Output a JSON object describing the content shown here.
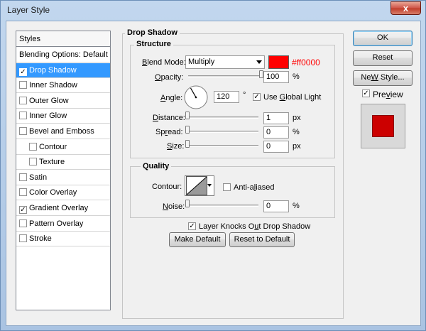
{
  "window": {
    "title": "Layer Style",
    "close_glyph": "x"
  },
  "styles_panel": {
    "header": "Styles",
    "items": [
      {
        "label": "Blending Options: Default",
        "checkbox": false,
        "checked": false,
        "selected": false,
        "indent": false
      },
      {
        "label": "Drop Shadow",
        "checkbox": true,
        "checked": true,
        "selected": true,
        "indent": false
      },
      {
        "label": "Inner Shadow",
        "checkbox": true,
        "checked": false,
        "selected": false,
        "indent": false
      },
      {
        "label": "Outer Glow",
        "checkbox": true,
        "checked": false,
        "selected": false,
        "indent": false
      },
      {
        "label": "Inner Glow",
        "checkbox": true,
        "checked": false,
        "selected": false,
        "indent": false
      },
      {
        "label": "Bevel and Emboss",
        "checkbox": true,
        "checked": false,
        "selected": false,
        "indent": false
      },
      {
        "label": "Contour",
        "checkbox": true,
        "checked": false,
        "selected": false,
        "indent": true
      },
      {
        "label": "Texture",
        "checkbox": true,
        "checked": false,
        "selected": false,
        "indent": true
      },
      {
        "label": "Satin",
        "checkbox": true,
        "checked": false,
        "selected": false,
        "indent": false
      },
      {
        "label": "Color Overlay",
        "checkbox": true,
        "checked": false,
        "selected": false,
        "indent": false
      },
      {
        "label": "Gradient Overlay",
        "checkbox": true,
        "checked": true,
        "selected": false,
        "indent": false
      },
      {
        "label": "Pattern Overlay",
        "checkbox": true,
        "checked": false,
        "selected": false,
        "indent": false
      },
      {
        "label": "Stroke",
        "checkbox": true,
        "checked": false,
        "selected": false,
        "indent": false
      }
    ]
  },
  "drop_shadow": {
    "title": "Drop Shadow",
    "structure": {
      "title": "Structure",
      "blend_mode_label_u": "B",
      "blend_mode_label_rest": "lend Mode:",
      "blend_mode_value": "Multiply",
      "shadow_color": "#ff0000",
      "shadow_color_text": "#ff0000",
      "opacity_label_u": "O",
      "opacity_label_rest": "pacity:",
      "opacity_value": "100",
      "opacity_level": 1.0,
      "opacity_unit": "%",
      "angle_label_u": "A",
      "angle_label_rest": "ngle:",
      "angle_value": "120",
      "angle_unit": "°",
      "use_global_light_label_u": "G",
      "use_global_light_label_pre": "Use ",
      "use_global_light_label_rest": "lobal Light",
      "use_global_light_checked": true,
      "distance_label_u": "D",
      "distance_label_rest": "istance:",
      "distance_value": "1",
      "distance_level": 0.0,
      "distance_unit": "px",
      "spread_label_pre": "Sp",
      "spread_label_u": "r",
      "spread_label_rest": "ead:",
      "spread_value": "0",
      "spread_level": 0.0,
      "spread_unit": "%",
      "size_label_u": "S",
      "size_label_rest": "ize:",
      "size_value": "0",
      "size_level": 0.0,
      "size_unit": "px"
    },
    "quality": {
      "title": "Quality",
      "contour_label": "Contour:",
      "anti_aliased_label_pre": "Anti-a",
      "anti_aliased_label_u": "l",
      "anti_aliased_label_rest": "iased",
      "anti_aliased_checked": false,
      "noise_label_u": "N",
      "noise_label_rest": "oise:",
      "noise_value": "0",
      "noise_level": 0.0,
      "noise_unit": "%"
    },
    "layer_knocks_out_label_pre": "Layer Knocks O",
    "layer_knocks_out_label_u": "u",
    "layer_knocks_out_label_rest": "t Drop Shadow",
    "layer_knocks_out_checked": true,
    "make_default_label": "Make Default",
    "reset_default_label": "Reset to Default"
  },
  "buttons": {
    "ok": "OK",
    "reset": "Reset",
    "new_style_u": "W",
    "new_style_pre": "Ne",
    "new_style_rest": " Style...",
    "preview_u": "v",
    "preview_pre": "Pre",
    "preview_rest": "iew",
    "preview_checked": true
  },
  "preview_swatch_color": "#cc0000"
}
